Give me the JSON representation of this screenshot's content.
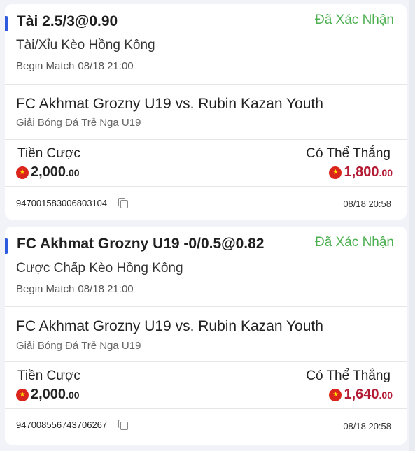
{
  "bets": [
    {
      "title": "Tài 2.5/3@0.90",
      "status": "Đã Xác Nhận",
      "market": "Tài/Xỉu Kèo Hồng Kông",
      "begin_label": "Begin Match",
      "begin_time": "08/18 21:00",
      "match": "FC Akhmat Grozny U19 vs. Rubin Kazan Youth",
      "league": "Giải Bóng Đá Trẻ Nga U19",
      "stake_label": "Tiền Cược",
      "stake_int": "2,000",
      "stake_dec": ".00",
      "win_label": "Có Thể Thắng",
      "win_int": "1,800",
      "win_dec": ".00",
      "ticket_id": "947001583006803104",
      "placed_time": "08/18 20:58"
    },
    {
      "title": "FC Akhmat Grozny U19 -0/0.5@0.82",
      "status": "Đã Xác Nhận",
      "market": "Cược Chấp Kèo Hồng Kông",
      "begin_label": "Begin Match",
      "begin_time": "08/18 21:00",
      "match": "FC Akhmat Grozny U19 vs. Rubin Kazan Youth",
      "league": "Giải Bóng Đá Trẻ Nga U19",
      "stake_label": "Tiền Cược",
      "stake_int": "2,000",
      "stake_dec": ".00",
      "win_label": "Có Thể Thắng",
      "win_int": "1,640",
      "win_dec": ".00",
      "ticket_id": "947008556743706267",
      "placed_time": "08/18 20:58"
    }
  ],
  "icons": {
    "currency": "vietnam-flag-icon",
    "copy": "copy-icon"
  },
  "colors": {
    "accent": "#2c5be0",
    "status": "#4caf50",
    "win_amount": "#b31b34",
    "background": "#f1f3f9"
  }
}
